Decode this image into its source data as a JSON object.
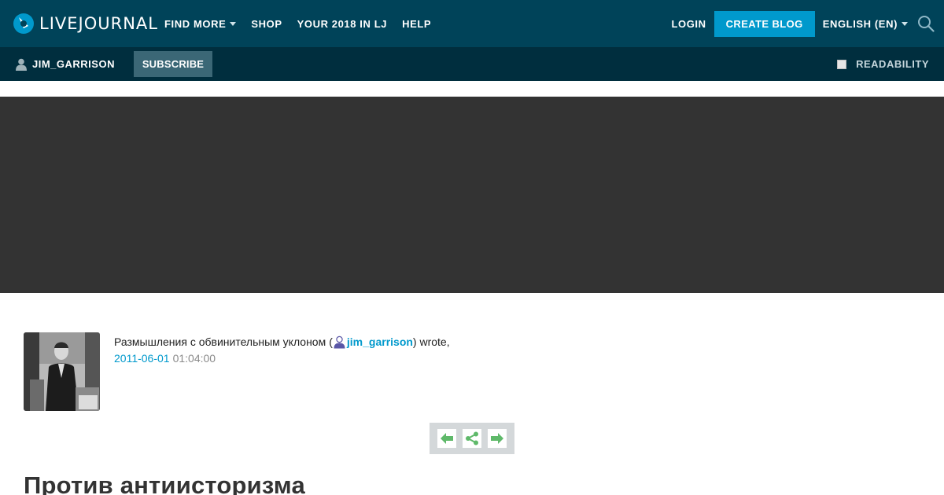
{
  "header": {
    "logo_text": "LIVEJOURNAL",
    "nav": [
      {
        "label": "FIND MORE",
        "dropdown": true
      },
      {
        "label": "SHOP",
        "dropdown": false
      },
      {
        "label": "YOUR 2018 IN LJ",
        "dropdown": false
      },
      {
        "label": "HELP",
        "dropdown": false
      }
    ],
    "login_label": "LOGIN",
    "create_blog_label": "CREATE BLOG",
    "language_label": "ENGLISH (EN)",
    "search_icon": "search-icon"
  },
  "subbar": {
    "username": "JIM_GARRISON",
    "subscribe_label": "SUBSCRIBE",
    "readability_label": "READABILITY"
  },
  "entry": {
    "journal_title": "Размышления с обвинительным уклоном",
    "open_paren": "(",
    "username": "jim_garrison",
    "close_text": ") wrote,",
    "date": "2011-06-01",
    "time": "01:04:00",
    "title": "Против антиисторизма"
  },
  "colors": {
    "topbar": "#004359",
    "subbar": "#002e3e",
    "accent": "#0099cc",
    "banner": "#333333",
    "control_green": "#5fb96a"
  }
}
